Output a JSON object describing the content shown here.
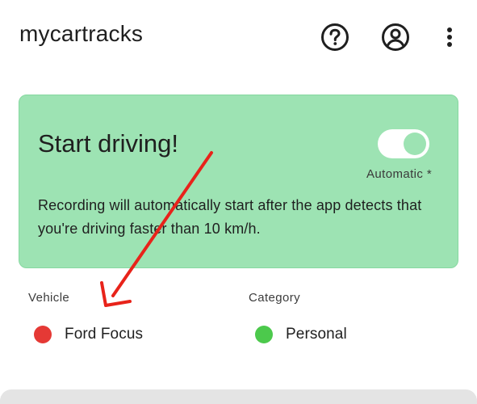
{
  "app_bar": {
    "title": "mycartracks",
    "icons": [
      "help-circle-icon",
      "account-circle-icon",
      "more-vertical-icon"
    ]
  },
  "recording_card": {
    "title": "Start driving!",
    "toggle_on": true,
    "toggle_label": "Automatic *",
    "description": "Recording will automatically start after the app detects that you're driving faster than 10 km/h.",
    "background_color": "#9de3b3"
  },
  "vehicle": {
    "label": "Vehicle",
    "value": "Ford Focus",
    "color": "#e53935"
  },
  "category": {
    "label": "Category",
    "value": "Personal",
    "color": "#4cc94c"
  },
  "annotation": {
    "type": "arrow",
    "color": "#e8231a"
  }
}
